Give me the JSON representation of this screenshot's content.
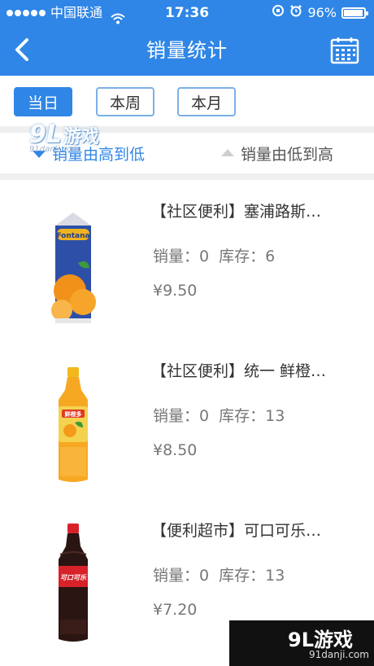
{
  "status": {
    "carrier": "中国联通",
    "time": "17:36",
    "battery": "96%",
    "battery_level": 0.96
  },
  "nav": {
    "title": "销量统计"
  },
  "filters": [
    {
      "label": "当日",
      "active": true
    },
    {
      "label": "本周",
      "active": false
    },
    {
      "label": "本月",
      "active": false
    }
  ],
  "sort": {
    "desc_label": "销量由高到低",
    "asc_label": "销量由低到高"
  },
  "products": [
    {
      "name": "【社区便利】塞浦路斯…",
      "stock_line": "销量：0  库存：6",
      "price": "¥9.50",
      "image": "orange-juice-carton"
    },
    {
      "name": "【社区便利】统一 鲜橙…",
      "stock_line": "销量：0  库存：13",
      "price": "¥8.50",
      "image": "orange-drink-bottle"
    },
    {
      "name": "【便利超市】可口可乐…",
      "stock_line": "销量：0  库存：13",
      "price": "¥7.20",
      "image": "cola-bottle"
    }
  ],
  "watermark": {
    "logo": "9L",
    "brand": "游戏",
    "site": "91danji.com"
  },
  "colors": {
    "primary": "#2f86e6",
    "separator": "#efefef",
    "text_dark": "#333333",
    "text_muted": "#777777"
  }
}
